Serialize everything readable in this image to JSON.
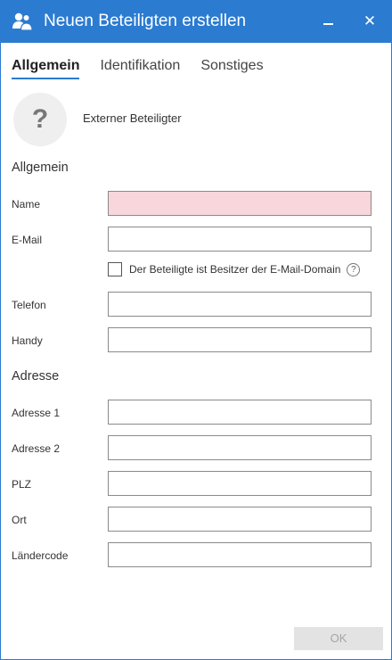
{
  "window": {
    "title": "Neuen Beteiligten erstellen",
    "icon": "people-group-icon",
    "close_glyph": "✕",
    "accent_color": "#2b7bd0"
  },
  "tabs": [
    {
      "label": "Allgemein",
      "active": true
    },
    {
      "label": "Identifikation",
      "active": false
    },
    {
      "label": "Sonstiges",
      "active": false
    }
  ],
  "avatar": {
    "glyph": "?",
    "label": "Externer Beteiligter"
  },
  "general": {
    "heading": "Allgemein",
    "name": {
      "label": "Name",
      "value": "",
      "invalid": true,
      "invalid_color": "#f9d6dc"
    },
    "email": {
      "label": "E-Mail",
      "value": ""
    },
    "domain_owner": {
      "label": "Der Beteiligte ist Besitzer der E-Mail-Domain",
      "checked": false,
      "help_glyph": "?"
    },
    "phone": {
      "label": "Telefon",
      "value": ""
    },
    "mobile": {
      "label": "Handy",
      "value": ""
    }
  },
  "address": {
    "heading": "Adresse",
    "address1": {
      "label": "Adresse 1",
      "value": ""
    },
    "address2": {
      "label": "Adresse 2",
      "value": ""
    },
    "zip": {
      "label": "PLZ",
      "value": ""
    },
    "city": {
      "label": "Ort",
      "value": ""
    },
    "country_code": {
      "label": "Ländercode",
      "value": ""
    }
  },
  "footer": {
    "ok_label": "OK",
    "ok_enabled": false
  }
}
